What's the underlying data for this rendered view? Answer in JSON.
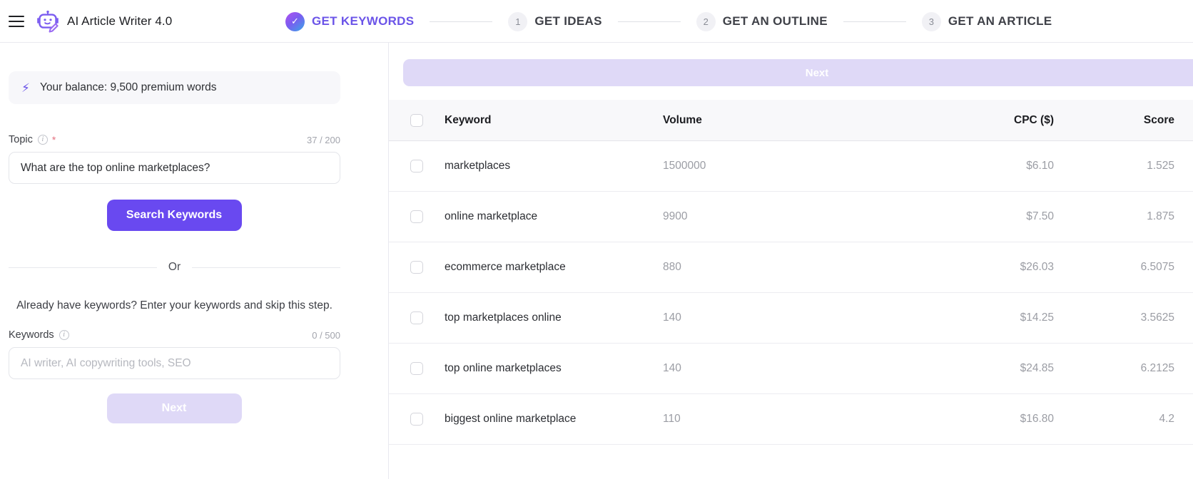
{
  "app": {
    "title": "AI Article Writer 4.0",
    "menu_icon": "hamburger-menu-icon",
    "logo_icon": "robot-writer-icon"
  },
  "steps": [
    {
      "badge": "✓",
      "label": "GET KEYWORDS",
      "state": "done"
    },
    {
      "badge": "1",
      "label": "GET IDEAS",
      "state": "pending"
    },
    {
      "badge": "2",
      "label": "GET AN OUTLINE",
      "state": "pending"
    },
    {
      "badge": "3",
      "label": "GET AN ARTICLE",
      "state": "pending"
    }
  ],
  "sidebar": {
    "balance": {
      "icon": "lightning-bolt-icon",
      "text": "Your balance: 9,500 premium words"
    },
    "topic": {
      "label": "Topic",
      "required_mark": "*",
      "info_icon": "info-icon",
      "counter": "37 / 200",
      "value": "What are the top online marketplaces?",
      "placeholder": "What are the top online marketplaces?"
    },
    "search_button": "Search Keywords",
    "divider_text": "Or",
    "hint": "Already have keywords? Enter your keywords and skip this step.",
    "keywords": {
      "label": "Keywords",
      "info_icon": "info-icon",
      "counter": "0 / 500",
      "value": "",
      "placeholder": "AI writer, AI copywriting tools, SEO"
    },
    "next_button": "Next"
  },
  "main": {
    "next_button": "Next",
    "table": {
      "columns": [
        "Keyword",
        "Volume",
        "CPC ($)",
        "Score"
      ],
      "select_all_checked": false,
      "rows": [
        {
          "checked": false,
          "keyword": "marketplaces",
          "volume": "1500000",
          "cpc": "$6.10",
          "score": "1.525"
        },
        {
          "checked": false,
          "keyword": "online marketplace",
          "volume": "9900",
          "cpc": "$7.50",
          "score": "1.875"
        },
        {
          "checked": false,
          "keyword": "ecommerce marketplace",
          "volume": "880",
          "cpc": "$26.03",
          "score": "6.5075"
        },
        {
          "checked": false,
          "keyword": "top marketplaces online",
          "volume": "140",
          "cpc": "$14.25",
          "score": "3.5625"
        },
        {
          "checked": false,
          "keyword": "top online marketplaces",
          "volume": "140",
          "cpc": "$24.85",
          "score": "6.2125"
        },
        {
          "checked": false,
          "keyword": "biggest online marketplace",
          "volume": "110",
          "cpc": "$16.80",
          "score": "4.2"
        }
      ]
    }
  },
  "colors": {
    "accent": "#6949f0",
    "accent_muted": "#dfd9f7",
    "step_active": "#6b54e8",
    "required": "#e4707f"
  }
}
